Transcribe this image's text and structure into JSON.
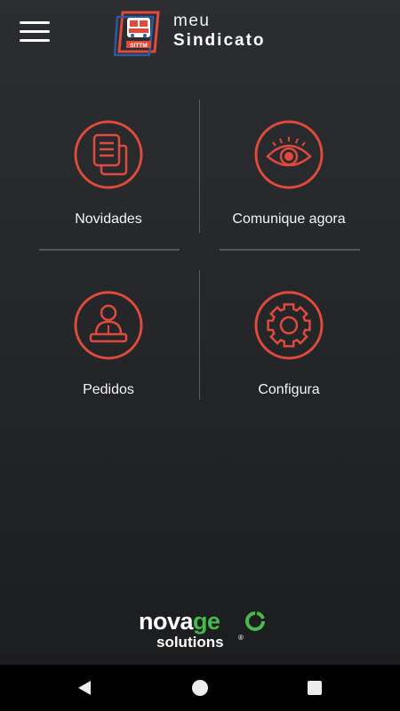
{
  "header": {
    "menu_icon": "hamburger-menu-icon",
    "logo_badge_text": "SITTM",
    "brand_line1": "meu",
    "brand_line2": "Sindicato"
  },
  "tiles": [
    {
      "label": "Novidades",
      "icon": "news-documents-icon"
    },
    {
      "label": "Comunique agora",
      "icon": "eye-icon"
    },
    {
      "label": "Pedidos",
      "icon": "person-at-desk-icon"
    },
    {
      "label": "Configura",
      "icon": "gear-icon"
    }
  ],
  "footer": {
    "brand_part1": "nova",
    "brand_part2": "ge",
    "brand_line2": "solutions",
    "registered_mark": "®"
  },
  "navbar": {
    "back_icon": "triangle-back-icon",
    "home_icon": "circle-home-icon",
    "recent_icon": "square-recents-icon"
  },
  "colors": {
    "accent": "#e04a3c",
    "background_top": "#2b2d30",
    "background_bottom": "#1b1c1e",
    "divider": "#55575b",
    "footer_accent": "#48b94a",
    "badge_blue": "#2c5a9e"
  }
}
